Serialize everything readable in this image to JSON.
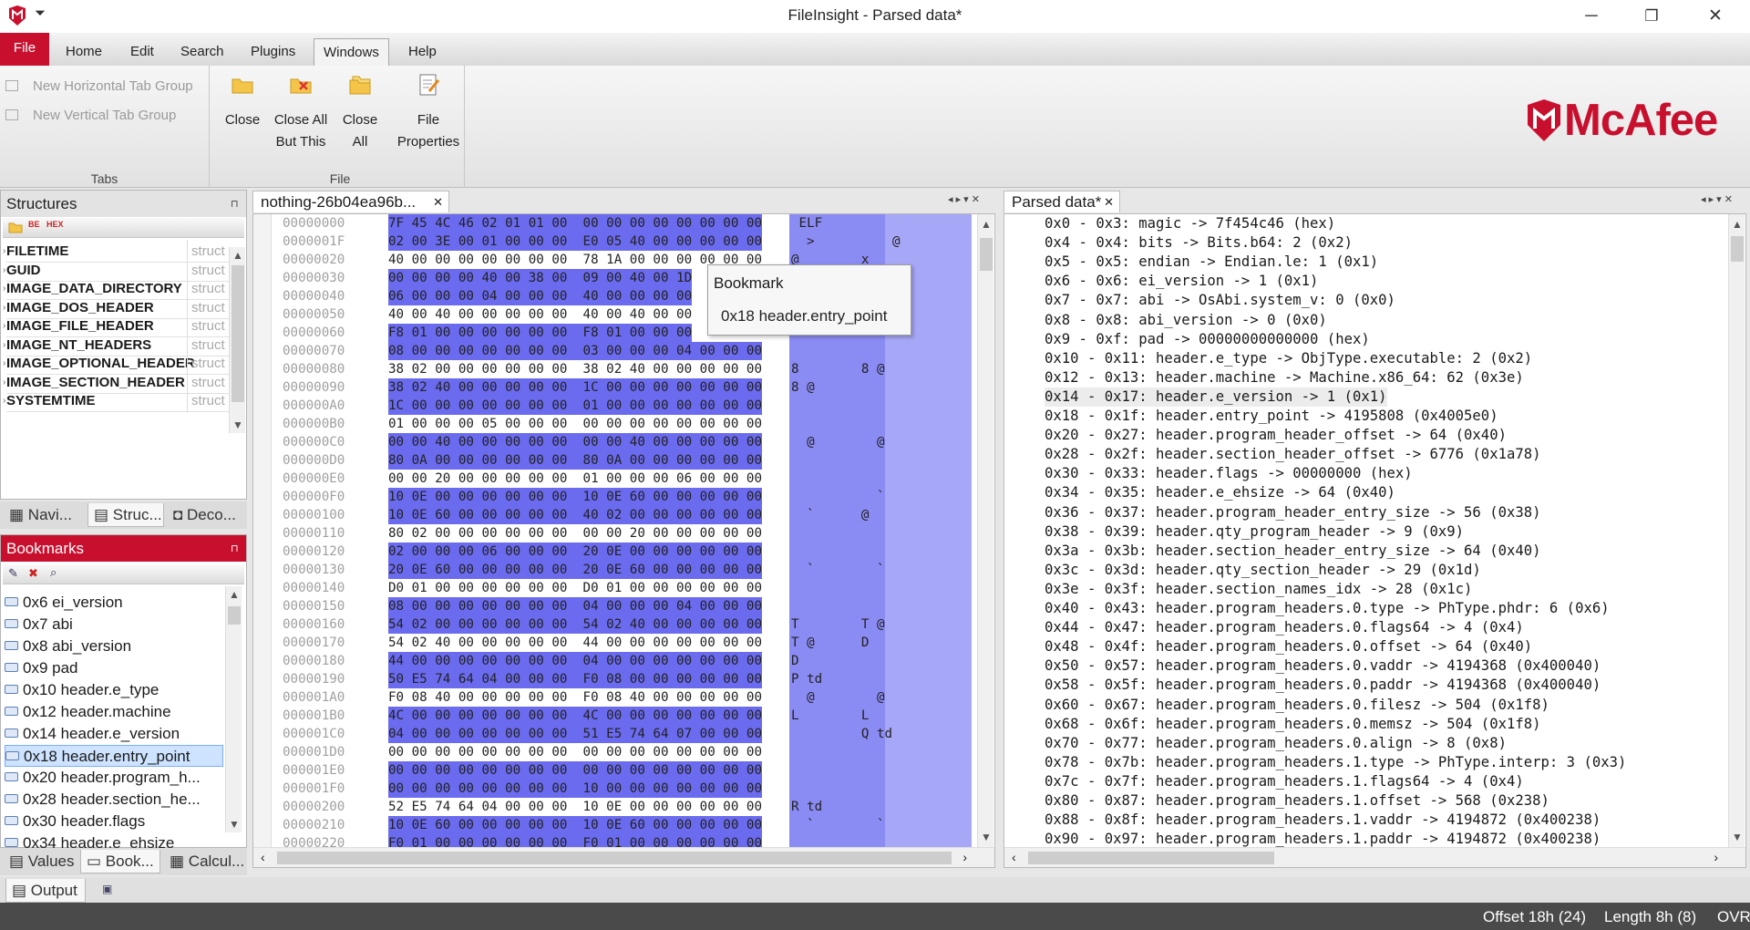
{
  "window": {
    "title": "FileInsight - Parsed data*",
    "qat": "⏷",
    "min": "─",
    "max": "❐",
    "close": "✕"
  },
  "ribbon_tabs": [
    "File",
    "Home",
    "Edit",
    "Search",
    "Plugins",
    "Windows",
    "Help"
  ],
  "ribbon": {
    "tabs_group": {
      "label": "Tabs",
      "items": [
        "New Horizontal Tab Group",
        "New Vertical Tab Group"
      ]
    },
    "file_group": {
      "label": "File",
      "close": "Close",
      "close_all_but_1": "Close All",
      "close_all_but_2": "But This",
      "close_all_1": "Close",
      "close_all_2": "All",
      "props_1": "File",
      "props_2": "Properties"
    },
    "brand": "McAfee"
  },
  "structures": {
    "title": "Structures",
    "type_label": "struct",
    "rows": [
      "FILETIME",
      "GUID",
      "IMAGE_DATA_DIRECTORY",
      "IMAGE_DOS_HEADER",
      "IMAGE_FILE_HEADER",
      "IMAGE_NT_HEADERS",
      "IMAGE_OPTIONAL_HEADER",
      "IMAGE_SECTION_HEADER",
      "SYSTEMTIME"
    ],
    "tabs": [
      "Navi...",
      "Struc...",
      "Deco..."
    ]
  },
  "bookmarks": {
    "title": "Bookmarks",
    "rows": [
      "0x6 ei_version",
      "0x7 abi",
      "0x8 abi_version",
      "0x9 pad",
      "0x10 header.e_type",
      "0x12 header.machine",
      "0x14 header.e_version",
      "0x18 header.entry_point",
      "0x20 header.program_h...",
      "0x28 header.section_he...",
      "0x30 header.flags",
      "0x34 header.e_ehsize"
    ],
    "selected": 7,
    "tabs": [
      "Values",
      "Book...",
      "Calcul..."
    ]
  },
  "output_tab": "Output",
  "hex": {
    "tab": "nothing-26b04ea96b...",
    "rows": [
      {
        "off": "00000000",
        "hex": "7F 45 4C 46 02 01 01 00  00 00 00 00 00 00 00 00",
        "asc": " ELF"
      },
      {
        "off": "0000001F",
        "hex": "02 00 3E 00 01 00 00 00  E0 05 40 00 00 00 00 00",
        "asc": "  >          @"
      },
      {
        "off": "00000020",
        "hex": "40 00 00 00 00 00 00 00  78 1A 00 00 00 00 00 00",
        "asc": "@        x"
      },
      {
        "off": "00000030",
        "hex": "00 00 00 00 40 00 38 00  09 00 40 00 1D",
        "asc": "        @ 8   @"
      },
      {
        "off": "00000040",
        "hex": "06 00 00 00 04 00 00 00  40 00 00 00 00",
        "asc": ""
      },
      {
        "off": "00000050",
        "hex": "40 00 40 00 00 00 00 00  40 00 40 00 00",
        "asc": ""
      },
      {
        "off": "00000060",
        "hex": "F8 01 00 00 00 00 00 00  F8 01 00 00 00",
        "asc": ""
      },
      {
        "off": "00000070",
        "hex": "08 00 00 00 00 00 00 00  03 00 00 00 04 00 00 00",
        "asc": ""
      },
      {
        "off": "00000080",
        "hex": "38 02 00 00 00 00 00 00  38 02 40 00 00 00 00 00",
        "asc": "8        8 @"
      },
      {
        "off": "00000090",
        "hex": "38 02 40 00 00 00 00 00  1C 00 00 00 00 00 00 00",
        "asc": "8 @"
      },
      {
        "off": "000000A0",
        "hex": "1C 00 00 00 00 00 00 00  01 00 00 00 00 00 00 00",
        "asc": ""
      },
      {
        "off": "000000B0",
        "hex": "01 00 00 00 05 00 00 00  00 00 00 00 00 00 00 00",
        "asc": ""
      },
      {
        "off": "000000C0",
        "hex": "00 00 40 00 00 00 00 00  00 00 40 00 00 00 00 00",
        "asc": "  @        @"
      },
      {
        "off": "000000D0",
        "hex": "80 0A 00 00 00 00 00 00  80 0A 00 00 00 00 00 00",
        "asc": ""
      },
      {
        "off": "000000E0",
        "hex": "00 00 20 00 00 00 00 00  01 00 00 00 06 00 00 00",
        "asc": ""
      },
      {
        "off": "000000F0",
        "hex": "10 0E 00 00 00 00 00 00  10 0E 60 00 00 00 00 00",
        "asc": "           `"
      },
      {
        "off": "00000100",
        "hex": "10 0E 60 00 00 00 00 00  40 02 00 00 00 00 00 00",
        "asc": "  `      @"
      },
      {
        "off": "00000110",
        "hex": "80 02 00 00 00 00 00 00  00 00 20 00 00 00 00 00",
        "asc": ""
      },
      {
        "off": "00000120",
        "hex": "02 00 00 00 06 00 00 00  20 0E 00 00 00 00 00 00",
        "asc": ""
      },
      {
        "off": "00000130",
        "hex": "20 0E 60 00 00 00 00 00  20 0E 60 00 00 00 00 00",
        "asc": "  `        `"
      },
      {
        "off": "00000140",
        "hex": "D0 01 00 00 00 00 00 00  D0 01 00 00 00 00 00 00",
        "asc": ""
      },
      {
        "off": "00000150",
        "hex": "08 00 00 00 00 00 00 00  04 00 00 00 04 00 00 00",
        "asc": ""
      },
      {
        "off": "00000160",
        "hex": "54 02 00 00 00 00 00 00  54 02 40 00 00 00 00 00",
        "asc": "T        T @"
      },
      {
        "off": "00000170",
        "hex": "54 02 40 00 00 00 00 00  44 00 00 00 00 00 00 00",
        "asc": "T @      D"
      },
      {
        "off": "00000180",
        "hex": "44 00 00 00 00 00 00 00  04 00 00 00 00 00 00 00",
        "asc": "D"
      },
      {
        "off": "00000190",
        "hex": "50 E5 74 64 04 00 00 00  F0 08 00 00 00 00 00 00",
        "asc": "P td"
      },
      {
        "off": "000001A0",
        "hex": "F0 08 40 00 00 00 00 00  F0 08 40 00 00 00 00 00",
        "asc": "  @        @"
      },
      {
        "off": "000001B0",
        "hex": "4C 00 00 00 00 00 00 00  4C 00 00 00 00 00 00 00",
        "asc": "L        L"
      },
      {
        "off": "000001C0",
        "hex": "04 00 00 00 00 00 00 00  51 E5 74 64 07 00 00 00",
        "asc": "         Q td"
      },
      {
        "off": "000001D0",
        "hex": "00 00 00 00 00 00 00 00  00 00 00 00 00 00 00 00",
        "asc": ""
      },
      {
        "off": "000001E0",
        "hex": "00 00 00 00 00 00 00 00  00 00 00 00 00 00 00 00",
        "asc": ""
      },
      {
        "off": "000001F0",
        "hex": "00 00 00 00 00 00 00 00  10 00 00 00 00 00 00 00",
        "asc": ""
      },
      {
        "off": "00000200",
        "hex": "52 E5 74 64 04 00 00 00  10 0E 00 00 00 00 00 00",
        "asc": "R td"
      },
      {
        "off": "00000210",
        "hex": "10 0E 60 00 00 00 00 00  10 0E 60 00 00 00 00 00",
        "asc": "  `        `"
      },
      {
        "off": "00000220",
        "hex": "F0 01 00 00 00 00 00 00  F0 01 00 00 00 00 00 00",
        "asc": ""
      }
    ],
    "tooltip": {
      "title": "Bookmark",
      "body": "0x18 header.entry_point"
    }
  },
  "parsed": {
    "tab": "Parsed data*",
    "selected": 9,
    "lines": [
      "0x0 - 0x3: magic -> 7f454c46 (hex)",
      "0x4 - 0x4: bits -> Bits.b64: 2 (0x2)",
      "0x5 - 0x5: endian -> Endian.le: 1 (0x1)",
      "0x6 - 0x6: ei_version -> 1 (0x1)",
      "0x7 - 0x7: abi -> OsAbi.system_v: 0 (0x0)",
      "0x8 - 0x8: abi_version -> 0 (0x0)",
      "0x9 - 0xf: pad -> 00000000000000 (hex)",
      "0x10 - 0x11: header.e_type -> ObjType.executable: 2 (0x2)",
      "0x12 - 0x13: header.machine -> Machine.x86_64: 62 (0x3e)",
      "0x14 - 0x17: header.e_version -> 1 (0x1)",
      "0x18 - 0x1f: header.entry_point -> 4195808 (0x4005e0)",
      "0x20 - 0x27: header.program_header_offset -> 64 (0x40)",
      "0x28 - 0x2f: header.section_header_offset -> 6776 (0x1a78)",
      "0x30 - 0x33: header.flags -> 00000000 (hex)",
      "0x34 - 0x35: header.e_ehsize -> 64 (0x40)",
      "0x36 - 0x37: header.program_header_entry_size -> 56 (0x38)",
      "0x38 - 0x39: header.qty_program_header -> 9 (0x9)",
      "0x3a - 0x3b: header.section_header_entry_size -> 64 (0x40)",
      "0x3c - 0x3d: header.qty_section_header -> 29 (0x1d)",
      "0x3e - 0x3f: header.section_names_idx -> 28 (0x1c)",
      "0x40 - 0x43: header.program_headers.0.type -> PhType.phdr: 6 (0x6)",
      "0x44 - 0x47: header.program_headers.0.flags64 -> 4 (0x4)",
      "0x48 - 0x4f: header.program_headers.0.offset -> 64 (0x40)",
      "0x50 - 0x57: header.program_headers.0.vaddr -> 4194368 (0x400040)",
      "0x58 - 0x5f: header.program_headers.0.paddr -> 4194368 (0x400040)",
      "0x60 - 0x67: header.program_headers.0.filesz -> 504 (0x1f8)",
      "0x68 - 0x6f: header.program_headers.0.memsz -> 504 (0x1f8)",
      "0x70 - 0x77: header.program_headers.0.align -> 8 (0x8)",
      "0x78 - 0x7b: header.program_headers.1.type -> PhType.interp: 3 (0x3)",
      "0x7c - 0x7f: header.program_headers.1.flags64 -> 4 (0x4)",
      "0x80 - 0x87: header.program_headers.1.offset -> 568 (0x238)",
      "0x88 - 0x8f: header.program_headers.1.vaddr -> 4194872 (0x400238)",
      "0x90 - 0x97: header.program_headers.1.paddr -> 4194872 (0x400238)"
    ]
  },
  "status": {
    "offset": "Offset 18h (24)",
    "length": "Length 8h (8)",
    "mode": "OVR"
  },
  "colors": {
    "accent": "#c8102e",
    "highlight": "#6b6bf0"
  }
}
